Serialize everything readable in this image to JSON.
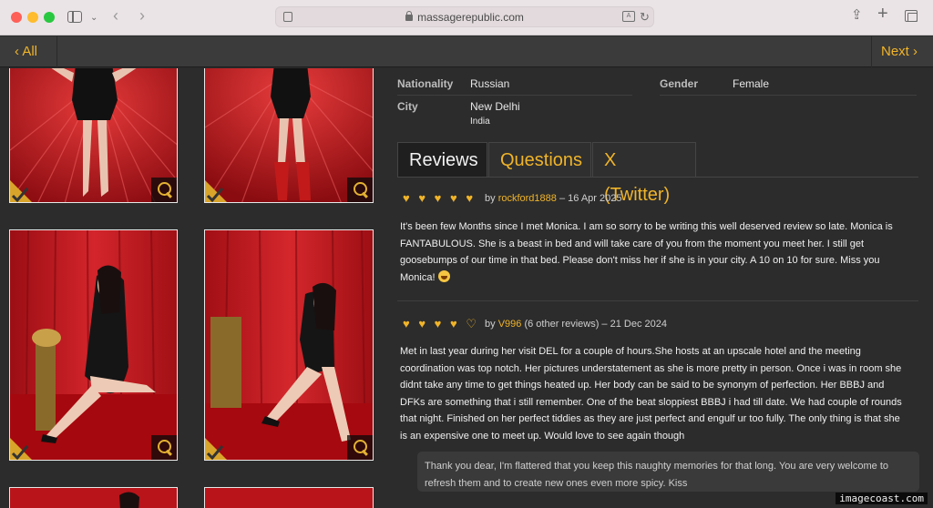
{
  "browser": {
    "url": "massagerepublic.com",
    "icons": [
      "sidebar-icon",
      "chevron-down-icon",
      "back-icon",
      "forward-icon",
      "page-icon",
      "lock-icon",
      "translate-icon",
      "reload-icon",
      "share-icon",
      "plus-icon",
      "tabs-icon"
    ]
  },
  "nav": {
    "all_label": "All",
    "next_label": "Next"
  },
  "info": {
    "nationality_label": "Nationality",
    "nationality_value": "Russian",
    "gender_label": "Gender",
    "gender_value": "Female",
    "city_label": "City",
    "city_value": "New Delhi",
    "city_country": "India"
  },
  "tabs": [
    {
      "label": "Reviews",
      "active": true
    },
    {
      "label": "Questions",
      "active": false
    },
    {
      "label": "X (Twitter)",
      "active": false
    }
  ],
  "reviews": [
    {
      "hearts": "♥ ♥ ♥ ♥ ♥",
      "by": "by",
      "author": "rockford1888",
      "suffix": "– 16 Apr 2025",
      "lines": [
        "It's been few Months since I met Monica. I am so sorry to be writing this well deserved review so late. Monica is",
        "FANTABULOUS. She is a beast in bed and will take care of you from the moment you meet her. I still get",
        "goosebumps of our time in that bed. Please don't miss her if she is in your city. A 10 on 10 for sure. Miss you",
        "Monica!"
      ]
    },
    {
      "hearts": "♥ ♥ ♥ ♥ ♡",
      "by": "by",
      "author": "V996",
      "suffix": "(6 other reviews) – 21 Dec 2024",
      "lines": [
        "Met in last year during her visit DEL for a couple of hours.She hosts at an upscale hotel and the meeting",
        "coordination was top notch. Her pictures understatement as she is more pretty in person. Once i was in room she",
        "didnt take any time to get things heated up. Her body can be said to be synonym of perfection. Her BBBJ and",
        "DFKs are something that i still remember. One of the beat sloppiest BBBJ i had till date. We had couple of rounds",
        "that night. Finished on her perfect tiddies as they are just perfect and engulf ur too fully. The only thing is that she",
        "is an expensive one to meet up. Would love to see again though"
      ],
      "reply_lines": [
        "Thank you dear, I'm flattered that you keep this naughty memories for that long. You are very welcome to",
        "refresh them and to create new ones even more spicy. Kiss"
      ]
    }
  ],
  "watermark": "imagecoast.com",
  "colors": {
    "accent": "#f0b429",
    "background": "#2c2c2c",
    "photo_red": "#c0161c"
  }
}
